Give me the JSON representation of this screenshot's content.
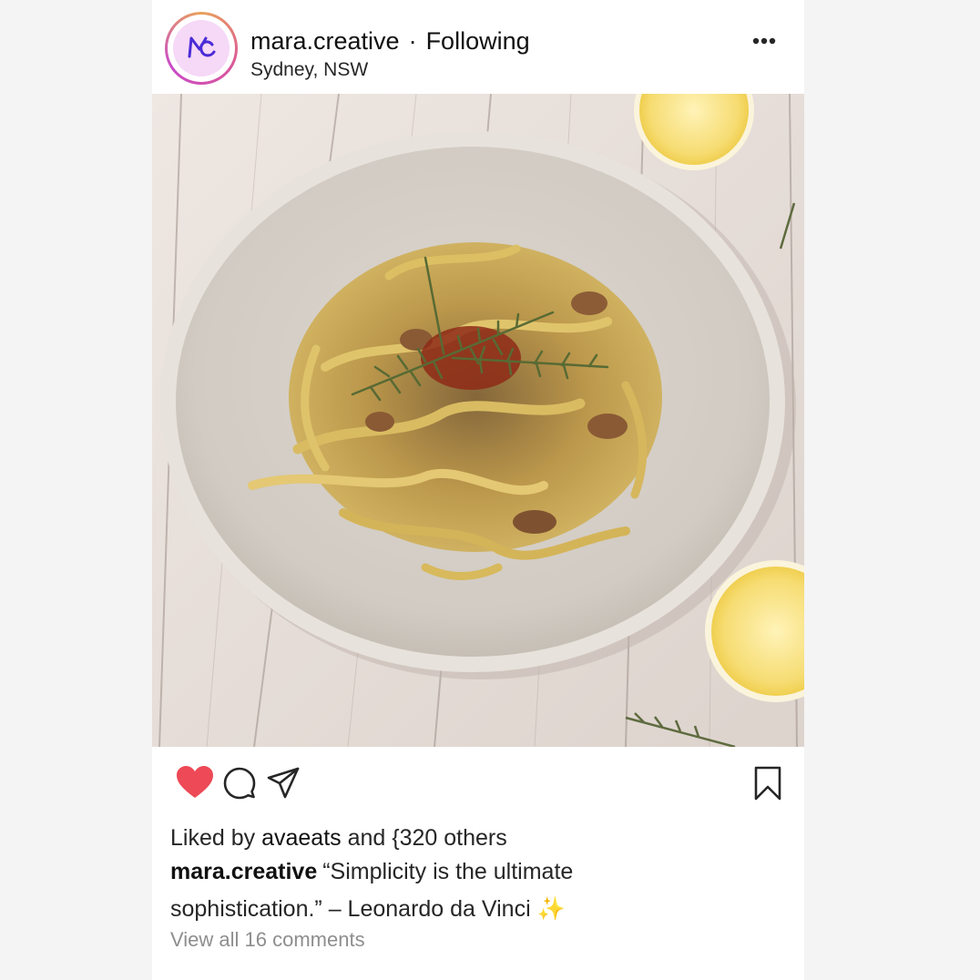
{
  "post": {
    "username": "mara.creative",
    "separator": "·",
    "follow_status": "Following",
    "location": "Sydney, NSW",
    "more_icon": "more-horizontal-icon",
    "liked_by_prefix": "Liked by",
    "liked_by_user": "avaeats",
    "liked_by_suffix": "and {320 others",
    "caption_user": "mara.creative",
    "caption_text": "“Simplicity is the ultimate sophistication.” – Leonardo da Vinci",
    "caption_emoji": "✨",
    "view_comments": "View all 16 comments",
    "liked": true
  },
  "colors": {
    "like_active": "#ed4956",
    "avatar_bg": "#f6d8f7",
    "avatar_mark": "#4a2bd6",
    "muted_text": "#8e8e8e"
  },
  "icons": [
    "heart-icon",
    "comment-icon",
    "share-icon",
    "bookmark-icon"
  ]
}
